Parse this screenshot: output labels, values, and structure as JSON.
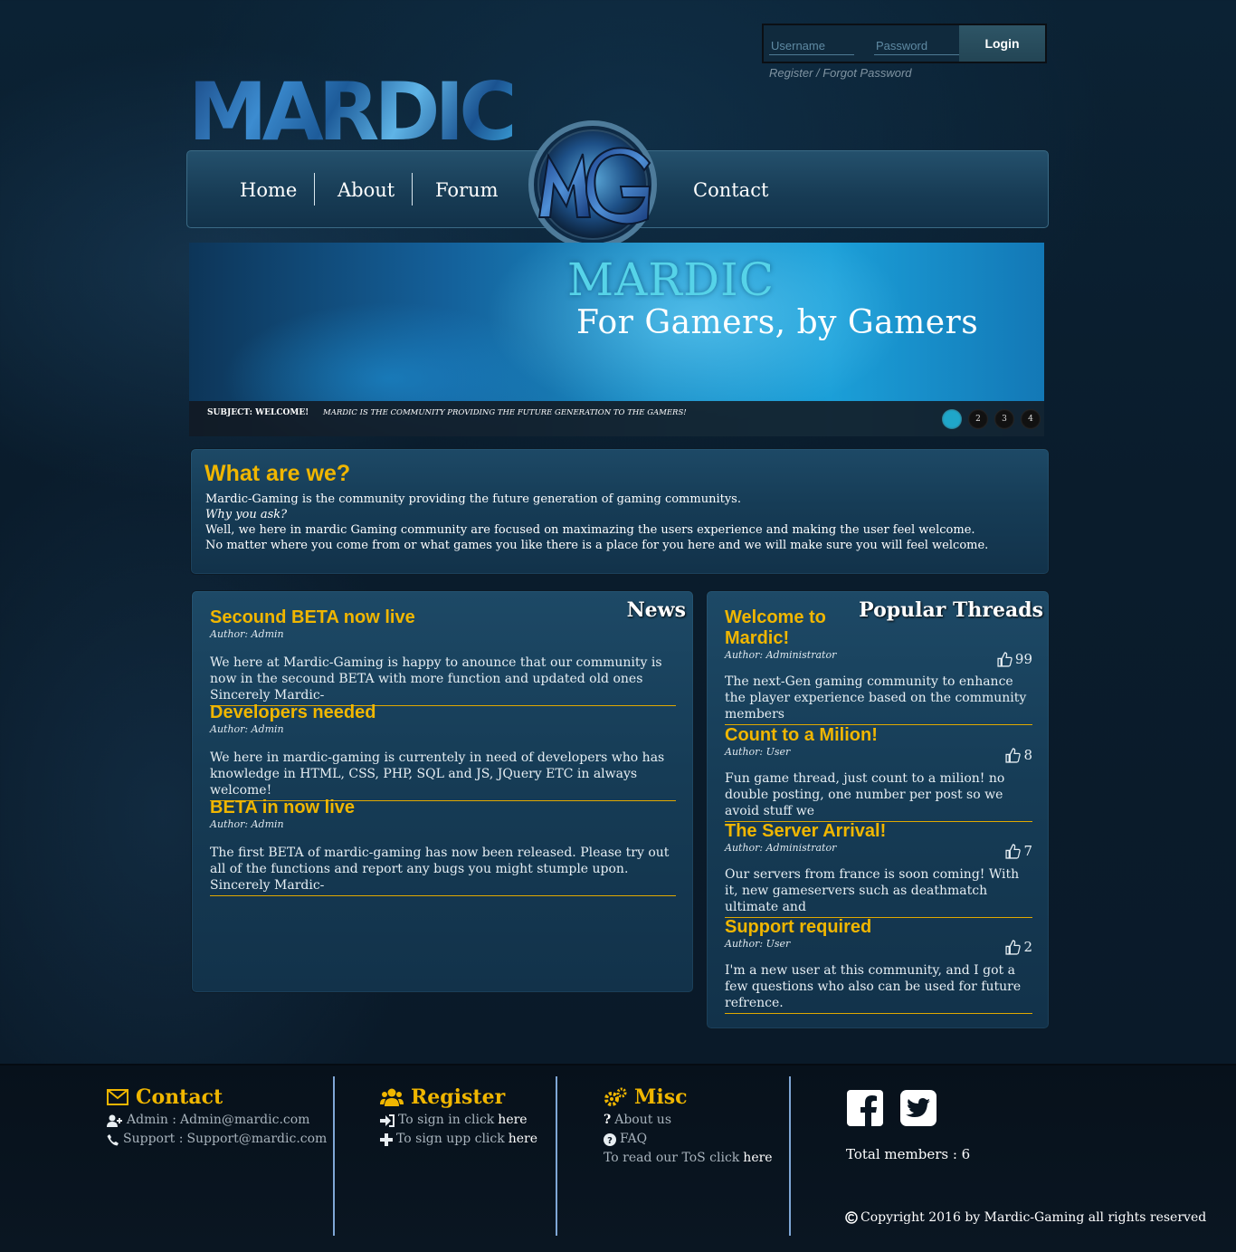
{
  "login": {
    "username_placeholder": "Username",
    "password_placeholder": "Password",
    "button": "Login",
    "register_link": "Register / Forgot Password"
  },
  "brand": {
    "logo_text": "MARDIC"
  },
  "nav": {
    "items": [
      "Home",
      "About",
      "Forum",
      "Contact"
    ]
  },
  "banner": {
    "title": "MARDIC",
    "tagline": "For Gamers, by Gamers",
    "subject_label": "SUBJECT: WELCOME!",
    "subject_text": "MARDIC IS THE COMMUNITY PROVIDING THE FUTURE GENERATION TO THE GAMERS!",
    "slides": [
      "1",
      "2",
      "3",
      "4"
    ],
    "active_slide": 1
  },
  "about": {
    "title": "What are we?",
    "line1": "Mardic-Gaming is the community providing the future generation of gaming communitys.",
    "line2": "Why you ask?",
    "line3": "Well, we here in mardic Gaming community are focused on maximazing the users experience and making the user feel welcome.",
    "line4": "No matter where you come from or what games you like there is a place for you here and we will make sure you will feel welcome."
  },
  "news": {
    "heading": "News",
    "posts": [
      {
        "title": "Secound BETA now live",
        "author": "Author: Admin",
        "body": "We here at Mardic-Gaming is happy to anounce that our community is now in the secound BETA with more function and updated old ones Sincerely Mardic-"
      },
      {
        "title": "Developers needed",
        "author": "Author: Admin",
        "body": "We here in mardic-gaming is currentely in need of developers who has knowledge in HTML, CSS, PHP, SQL and JS, JQuery ETC in always welcome!"
      },
      {
        "title": "BETA in now live",
        "author": "Author: Admin",
        "body": "The first BETA of mardic-gaming has now been released. Please try out all of the functions and report any bugs you might stumple upon. Sincerely Mardic-"
      }
    ]
  },
  "threads": {
    "heading": "Popular Threads",
    "posts": [
      {
        "title": "Welcome to Mardic!",
        "author": "Author: Administrator",
        "likes": "99",
        "body": "The next-Gen gaming community to enhance the player experience based on the community members"
      },
      {
        "title": "Count to a Milion!",
        "author": "Author: User",
        "likes": "8",
        "body": "Fun game thread, just count to a milion! no double posting, one number per post so we avoid stuff we"
      },
      {
        "title": "The Server Arrival!",
        "author": "Author: Administrator",
        "likes": "7",
        "body": "Our servers from france is soon coming! With it, new gameservers such as deathmatch ultimate and"
      },
      {
        "title": "Support required",
        "author": "Author: User",
        "likes": "2",
        "body": "I'm a new user at this community, and I got a few questions who also can be used for future refrence."
      }
    ]
  },
  "footer": {
    "contact": {
      "title": "Contact",
      "admin_label": "Admin : ",
      "admin_email": "Admin@mardic.com",
      "support_label": "Support : ",
      "support_email": "Support@mardic.com"
    },
    "register": {
      "title": "Register",
      "signin_text": "To sign in click ",
      "signup_text": "To sign upp click ",
      "link": "here"
    },
    "misc": {
      "title": "Misc",
      "about": "About us",
      "faq": "FAQ",
      "tos_text": "To read our ToS click ",
      "link": "here"
    },
    "total_members": "Total members : 6",
    "copyright": "Copyright 2016 by Mardic-Gaming all rights reserved"
  },
  "colors": {
    "accent": "#f0b600",
    "panel": "#173b54",
    "slide_active": "#1fa6c9"
  },
  "icons": [
    "envelope-icon",
    "user-plus-icon",
    "phone-icon",
    "users-icon",
    "sign-in-icon",
    "plus-icon",
    "cogs-icon",
    "question-icon",
    "question-circle-icon",
    "facebook-icon",
    "twitter-icon",
    "thumbs-up-icon",
    "copyright-icon"
  ]
}
